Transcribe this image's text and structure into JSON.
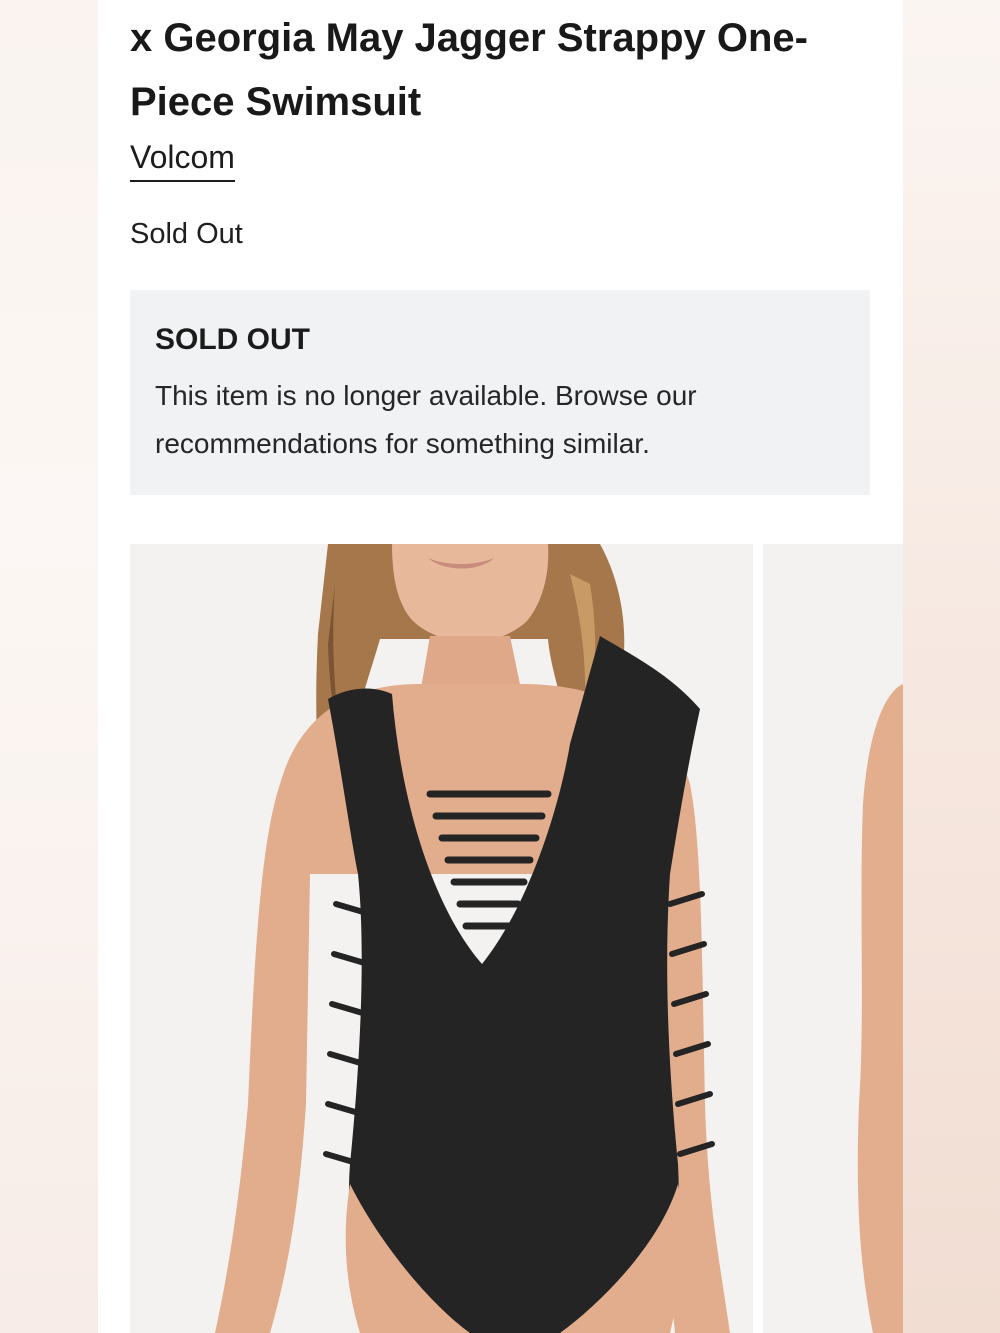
{
  "product": {
    "title": "x Georgia May Jagger Strappy One-Piece Swimsuit",
    "brand": "Volcom",
    "price_status": "Sold Out"
  },
  "notice": {
    "title": "SOLD OUT",
    "body": "This item is no longer available. Browse our recommendations for something similar."
  },
  "gallery": {
    "images": [
      {
        "subject": "model wearing black strappy one-piece swimsuit, front view"
      },
      {
        "subject": "model side view, partially visible"
      }
    ]
  },
  "colors": {
    "notice_background": "#f1f2f4",
    "text": "#1c1c1c",
    "swimsuit": "#232323"
  }
}
